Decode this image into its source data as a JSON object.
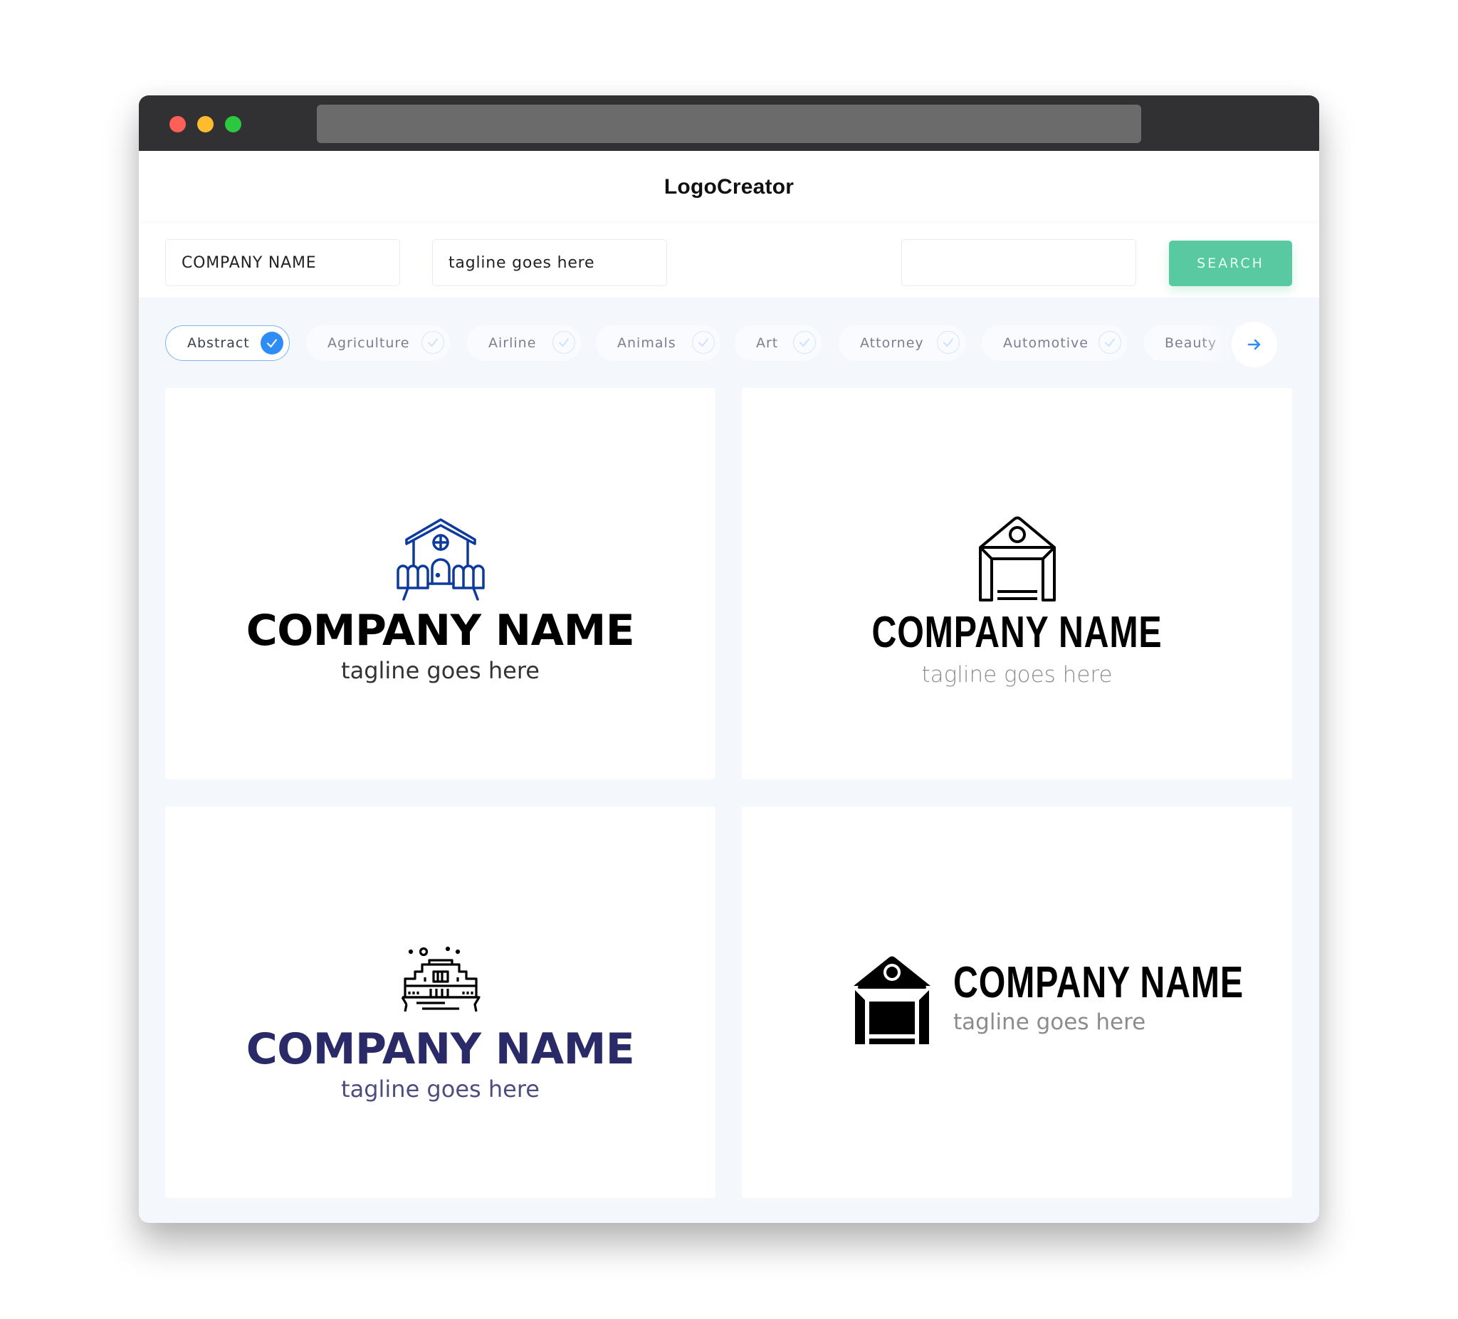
{
  "window": {
    "traffic_lights": [
      "close",
      "minimize",
      "maximize"
    ],
    "url": ""
  },
  "header": {
    "title": "LogoCreator"
  },
  "search": {
    "company_name_value": "COMPANY NAME",
    "tagline_value": "tagline goes here",
    "keyword_value": "",
    "button_label": "SEARCH"
  },
  "categories": [
    {
      "label": "Abstract",
      "selected": true
    },
    {
      "label": "Agriculture",
      "selected": false
    },
    {
      "label": "Airline",
      "selected": false
    },
    {
      "label": "Animals",
      "selected": false
    },
    {
      "label": "Art",
      "selected": false
    },
    {
      "label": "Attorney",
      "selected": false
    },
    {
      "label": "Automotive",
      "selected": false
    },
    {
      "label": "Beauty",
      "selected": false
    }
  ],
  "next_icon": "arrow-right-icon",
  "logos": [
    {
      "icon": "house-with-fence-icon",
      "company": "COMPANY NAME",
      "tagline": "tagline goes here",
      "icon_color": "#0d3a9e",
      "name_color": "#000000",
      "tagline_color": "#333333"
    },
    {
      "icon": "garage-outline-icon",
      "company": "COMPANY NAME",
      "tagline": "tagline goes here",
      "icon_color": "#000000",
      "name_color": "#000000",
      "tagline_color": "#8c8c8c"
    },
    {
      "icon": "palace-building-icon",
      "company": "COMPANY NAME",
      "tagline": "tagline goes here",
      "icon_color": "#000000",
      "name_color": "#2a2a68",
      "tagline_color": "#4d4d80"
    },
    {
      "icon": "garage-solid-icon",
      "company": "COMPANY NAME",
      "tagline": "tagline goes here",
      "icon_color": "#000000",
      "name_color": "#000000",
      "tagline_color": "#8c8c8c"
    }
  ],
  "colors": {
    "titlebar": "#313133",
    "search_button": "#59c9a1",
    "accent_blue": "#2e8cf5",
    "page_bg": "#f4f7fc"
  }
}
